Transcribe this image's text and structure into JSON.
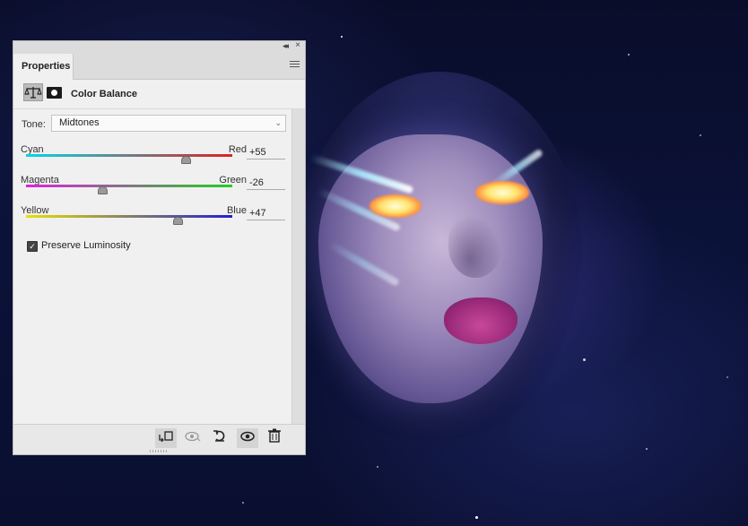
{
  "panel": {
    "tab_label": "Properties",
    "collapse_glyph": "◂◂",
    "close_glyph": "×",
    "adjustment_title": "Color Balance",
    "tone": {
      "label": "Tone:",
      "value": "Midtones"
    },
    "sliders": [
      {
        "left_label": "Cyan",
        "right_label": "Red",
        "value": "+55",
        "fraction": 0.775,
        "gradient": [
          "#00d8e8",
          "#e02020"
        ]
      },
      {
        "left_label": "Magenta",
        "right_label": "Green",
        "value": "-26",
        "fraction": 0.37,
        "gradient": [
          "#e020e0",
          "#20d020"
        ]
      },
      {
        "left_label": "Yellow",
        "right_label": "Blue",
        "value": "+47",
        "fraction": 0.735,
        "gradient": [
          "#e8e000",
          "#2020d0"
        ]
      }
    ],
    "preserve_luminosity": {
      "label": "Preserve Luminosity",
      "checked": true
    },
    "bottom_icons": [
      "clip-to-layer-icon",
      "view-previous-state-icon",
      "reset-icon",
      "visibility-icon",
      "delete-icon"
    ]
  },
  "colors": {
    "panel_bg": "#f0f0f0",
    "background": "#070a22"
  }
}
